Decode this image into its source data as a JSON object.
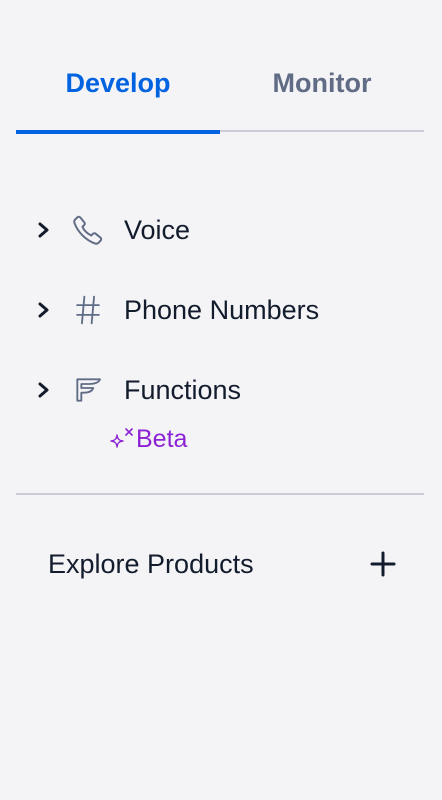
{
  "tabs": [
    {
      "label": "Develop",
      "active": true
    },
    {
      "label": "Monitor",
      "active": false
    }
  ],
  "nav": {
    "items": [
      {
        "label": "Voice",
        "icon": "phone-icon"
      },
      {
        "label": "Phone Numbers",
        "icon": "hash-icon"
      },
      {
        "label": "Functions",
        "icon": "functions-icon",
        "badge": "Beta"
      }
    ]
  },
  "explore": {
    "label": "Explore Products",
    "icon": "plus-icon"
  },
  "colors": {
    "accent": "#0263e0",
    "tab_inactive": "#606b85",
    "text": "#121c2d",
    "beta": "#8c22d5",
    "divider": "#cacdd8",
    "background": "#f4f4f6"
  }
}
